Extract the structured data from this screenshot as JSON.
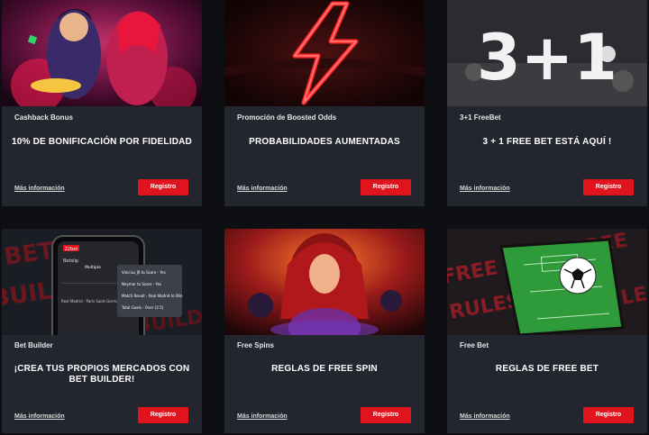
{
  "cards": [
    {
      "category": "Cashback Bonus",
      "headline": "10% DE BONIFICACIÓN POR FIDELIDAD",
      "more": "Más información",
      "cta": "Registro",
      "image": "cartoon-heroes-banner"
    },
    {
      "category": "Promoción de Boosted Odds",
      "headline": "PROBABILIDADES AUMENTADAS",
      "more": "Más información",
      "cta": "Registro",
      "image": "red-lightning-bolt"
    },
    {
      "category": "3+1 FreeBet",
      "headline": "3 + 1 FREE BET ESTÁ AQUÍ !",
      "more": "Más información",
      "cta": "Registro",
      "image": "3-plus-1-soccer-banner",
      "image_text": "3+1"
    },
    {
      "category": "Bet Builder",
      "headline": "¡CREA TUS PROPIOS MERCADOS CON BET BUILDER!",
      "more": "Más información",
      "cta": "Registro",
      "image": "bet-builder-phone-banner",
      "phone": {
        "brand": "22bet",
        "tab": "Betslip",
        "tab2": "Multiple",
        "match": "Real Madrid - Paris Saint-Germain",
        "popup": [
          "Vinicius JR to Score - Yes",
          "Neymar to Score - Yes",
          "Match Result - Real Madrid to Win",
          "Total Goals - Over (2.5)"
        ]
      },
      "bg_words": [
        "BET",
        "BUILDER"
      ]
    },
    {
      "category": "Free Spins",
      "headline": "REGLAS DE FREE SPIN",
      "more": "Más información",
      "cta": "Registro",
      "image": "casino-heroine-banner"
    },
    {
      "category": "Free Bet",
      "headline": "REGLAS DE FREE BET",
      "more": "Más información",
      "cta": "Registro",
      "image": "phone-soccer-field-banner",
      "bg_words": [
        "FREE",
        "BET",
        "RULES"
      ]
    }
  ],
  "colors": {
    "page_bg": "#0e0f12",
    "card_bg": "#23262e",
    "accent": "#e0141e"
  }
}
